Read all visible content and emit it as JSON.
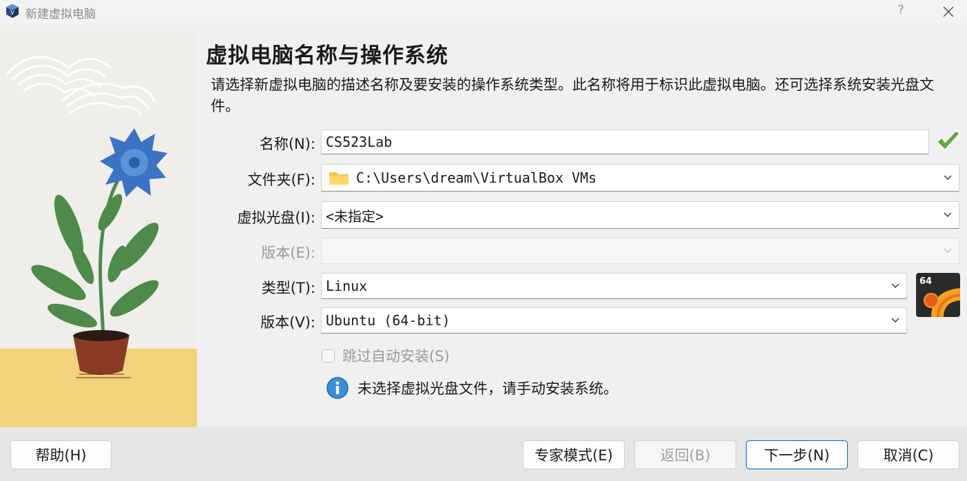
{
  "window": {
    "title": "新建虚拟电脑",
    "help_glyph": "?"
  },
  "page": {
    "title": "虚拟电脑名称与操作系统",
    "description": "请选择新虚拟电脑的描述名称及要安装的操作系统类型。此名称将用于标识此虚拟电脑。还可选择系统安装光盘文件。"
  },
  "form": {
    "name_label": "名称(N):",
    "name_value": "CS523Lab",
    "folder_label": "文件夹(F):",
    "folder_value": "C:\\Users\\dream\\VirtualBox VMs",
    "iso_label": "虚拟光盘(I):",
    "iso_value": "<未指定>",
    "edition_label": "版本(E):",
    "edition_value": "",
    "type_label": "类型(T):",
    "type_value": "Linux",
    "version_label": "版本(V):",
    "version_value": "Ubuntu (64-bit)",
    "os_badge": "64",
    "skip_unattended_label": "跳过自动安装(S)",
    "skip_unattended_checked": false
  },
  "info": {
    "message": "未选择虚拟光盘文件，请手动安装系统。"
  },
  "buttons": {
    "help": "帮助(H)",
    "expert": "专家模式(E)",
    "back": "返回(B)",
    "next": "下一步(N)",
    "cancel": "取消(C)"
  },
  "colors": {
    "accent": "#0067c0",
    "valid_check": "#5fb336",
    "flower": "#3b73c4",
    "leaves": "#4e8a4a",
    "pot": "#8a3b24",
    "ground": "#f2d27a"
  },
  "icons": [
    "virtualbox-icon",
    "close-icon",
    "folder-icon",
    "chevron-down-icon",
    "check-icon",
    "ubuntu-os-icon",
    "info-icon"
  ]
}
